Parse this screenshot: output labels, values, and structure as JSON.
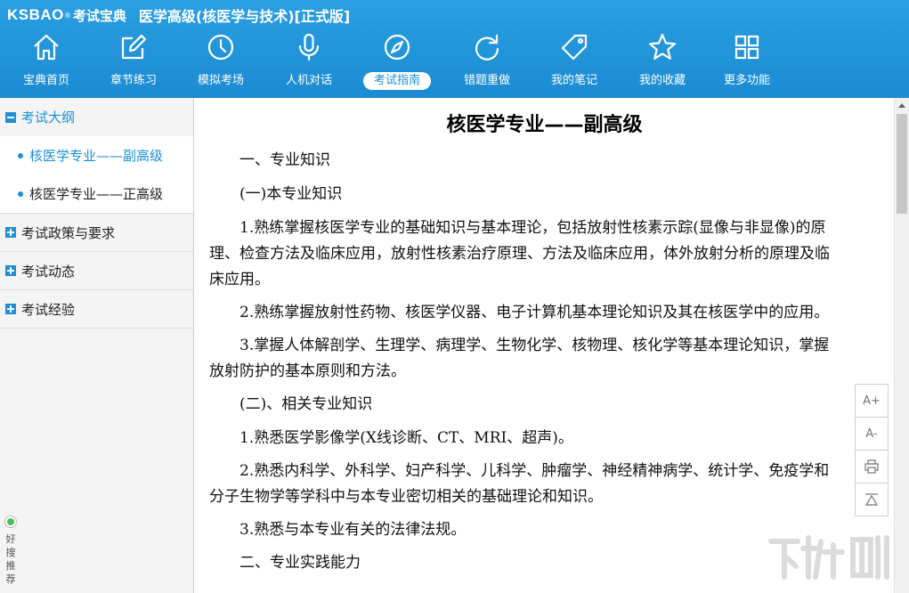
{
  "app": {
    "brand_logo": "KSBAO",
    "brand_reg": "®",
    "brand_name": "考试宝典",
    "title": "医学高级(核医学与技术)[正式版]"
  },
  "nav": [
    {
      "label": "宝典首页",
      "icon": "home-icon"
    },
    {
      "label": "章节练习",
      "icon": "edit-icon"
    },
    {
      "label": "模拟考场",
      "icon": "clock-icon"
    },
    {
      "label": "人机对话",
      "icon": "microphone-icon"
    },
    {
      "label": "考试指南",
      "icon": "compass-icon",
      "active": true
    },
    {
      "label": "错题重做",
      "icon": "refresh-icon"
    },
    {
      "label": "我的笔记",
      "icon": "tag-icon"
    },
    {
      "label": "我的收藏",
      "icon": "star-icon"
    },
    {
      "label": "更多功能",
      "icon": "grid-icon"
    }
  ],
  "sidebar": {
    "section_outline": "考试大纲",
    "items": [
      {
        "label": "核医学专业——副高级",
        "active": true
      },
      {
        "label": "核医学专业——正高级"
      }
    ],
    "section_policy": "考试政策与要求",
    "section_news": "考试动态",
    "section_experience": "考试经验",
    "recommend": "好搜推荐"
  },
  "content": {
    "title": "核医学专业——副高级",
    "paragraphs": [
      "一、专业知识",
      "(一)本专业知识",
      "1.熟练掌握核医学专业的基础知识与基本理论，包括放射性核素示踪(显像与非显像)的原理、检查方法及临床应用，放射性核素治疗原理、方法及临床应用，体外放射分析的原理及临床应用。",
      "2.熟练掌握放射性药物、核医学仪器、电子计算机基本理论知识及其在核医学中的应用。",
      "3.掌握人体解剖学、生理学、病理学、生物化学、核物理、核化学等基本理论知识，掌握放射防护的基本原则和方法。",
      "(二)、相关专业知识",
      "1.熟悉医学影像学(X线诊断、CT、MRI、超声)。",
      "2.熟悉内科学、外科学、妇产科学、儿科学、肿瘤学、神经精神病学、统计学、免疫学和分子生物学等学科中与本专业密切相关的基础理论和知识。",
      "3.熟悉与本专业有关的法律法规。",
      "二、专业实践能力"
    ]
  },
  "tools": {
    "font_up": "A+",
    "font_down": "A-"
  },
  "colors": {
    "header": "#1d8fd6",
    "accent": "#1d8fd6"
  }
}
